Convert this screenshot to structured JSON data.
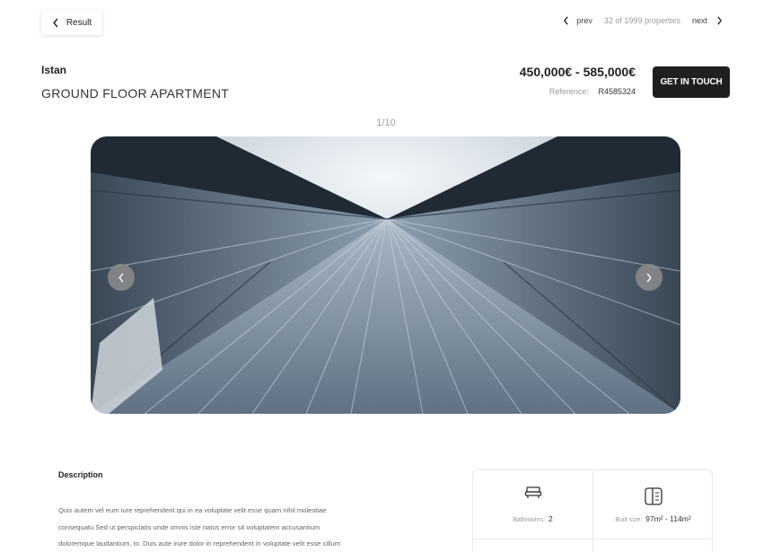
{
  "header": {
    "back_label": "Result",
    "pager": {
      "prev_label": "prev",
      "count_text": "32 of 1999 properties",
      "next_label": "next"
    }
  },
  "property": {
    "location": "Istan",
    "type": "GROUND FLOOR APARTMENT",
    "price": "450,000€  -  585,000€",
    "reference_label": "Reference:",
    "reference_value": "R4585324",
    "cta_label": "GET IN TOUCH"
  },
  "gallery": {
    "counter": "1/10"
  },
  "description": {
    "title": "Description",
    "lines": [
      "Quis autem vel eum iure reprehenderit qui in ea voluptate velit esse quam nihil molestiae",
      "consequatu Sed ut perspiciatis unde omnis iste natus error sit voluptatem accusantium",
      "doloremque laudantium, to. Duis aute irure dolor in reprehenderit in voluptate velit esse cillum"
    ]
  },
  "facts": [
    {
      "icon": "bathtub-icon",
      "label": "Bathrooms:",
      "value": "2"
    },
    {
      "icon": "door-icon",
      "label": "Built size:",
      "value": "97m² - 114m²"
    }
  ],
  "colors": {
    "cta_background": "#1f1f1f",
    "muted_text": "#9a9a9a",
    "border": "#eaeaea"
  }
}
